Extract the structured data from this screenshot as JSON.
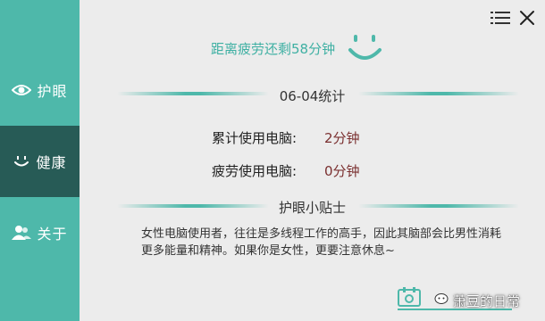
{
  "sidebar": {
    "items": [
      {
        "label": "护眼",
        "icon": "eye-icon"
      },
      {
        "label": "健康",
        "icon": "smile-icon"
      },
      {
        "label": "关于",
        "icon": "users-icon"
      }
    ],
    "active_index": 1
  },
  "header": {
    "countdown": "距离疲劳还剩58分钟",
    "menu_icon": "menu-icon",
    "close_icon": "close-icon"
  },
  "stats": {
    "date_title": "06-04统计",
    "rows": [
      {
        "label": "累计使用电脑:",
        "value": "2分钟"
      },
      {
        "label": "疲劳使用电脑:",
        "value": "0分钟"
      }
    ]
  },
  "tips": {
    "title": "护眼小贴士",
    "text": "女性电脑使用者，往往是多线程工作的高手，因此其脑部会比男性消耗更多能量和精神。如果你是女性，更要注意休息~"
  },
  "watermark": {
    "text": "萧豆的日常"
  },
  "colors": {
    "accent": "#4eb8aa",
    "sidebar_active": "#275b56",
    "value": "#7a2f2f",
    "background": "#ececec"
  }
}
